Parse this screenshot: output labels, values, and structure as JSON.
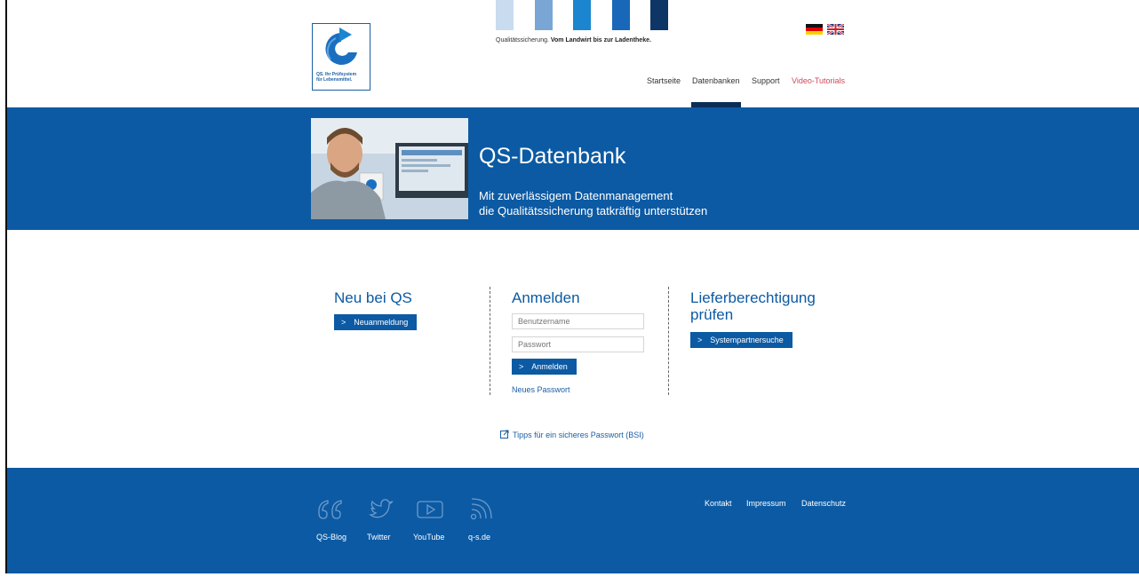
{
  "header": {
    "logo_text": "QS. Ihr Prüfsystem\nfür Lebensmittel.",
    "tagline_normal": "Qualitätssicherung. ",
    "tagline_bold": "Vom Landwirt bis zur Ladentheke.",
    "square_colors": [
      "#c9dbef",
      "#7aa6d6",
      "#1b86cf",
      "#1967b8",
      "#0d3566"
    ],
    "nav": [
      {
        "label": "Startseite"
      },
      {
        "label": "Datenbanken"
      },
      {
        "label": "Support"
      },
      {
        "label": "Video-Tutorials"
      }
    ]
  },
  "hero": {
    "title": "QS-Datenbank",
    "subtitle_line1": "Mit zuverlässigem Datenmanagement",
    "subtitle_line2": "die Qualitätssicherung tatkräftig unterstützen"
  },
  "new": {
    "title": "Neu bei QS",
    "button": "Neuanmeldung"
  },
  "login": {
    "title": "Anmelden",
    "username_placeholder": "Benutzername",
    "password_placeholder": "Passwort",
    "button": "Anmelden",
    "forgot": "Neues Passwort"
  },
  "delivery": {
    "title_line1": "Lieferberechtigung",
    "title_line2": "prüfen",
    "button": "Systempartnersuche"
  },
  "tips_link": "Tipps für ein sicheres Passwort (BSI)",
  "footer": {
    "social": [
      {
        "label": "QS-Blog",
        "icon": "quote-icon"
      },
      {
        "label": "Twitter",
        "icon": "twitter-bird-icon"
      },
      {
        "label": "YouTube",
        "icon": "youtube-play-icon"
      },
      {
        "label": "q-s.de",
        "icon": "rss-icon"
      }
    ],
    "links": [
      "Kontakt",
      "Impressum",
      "Datenschutz"
    ]
  },
  "colors": {
    "primary_blue": "#0c5aa3",
    "dark_blue": "#0c2d57",
    "nav_active_red": "#d1495b"
  }
}
